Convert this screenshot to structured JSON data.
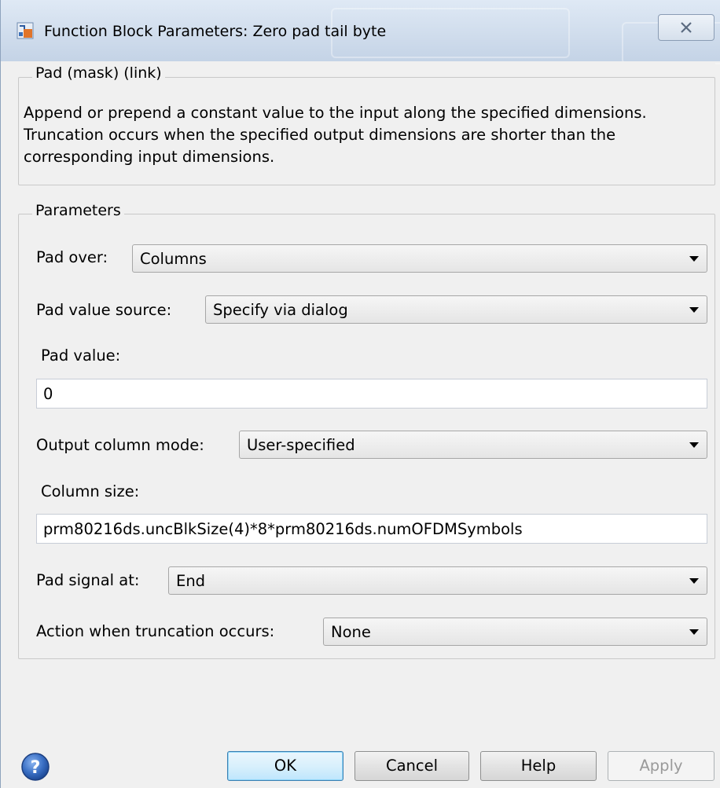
{
  "window": {
    "title": "Function Block Parameters: Zero pad tail byte"
  },
  "description_group": {
    "label": "Pad (mask) (link)",
    "text": "Append or prepend a constant value to the input along the specified dimensions.  Truncation occurs when the specified output dimensions are shorter than the corresponding input dimensions."
  },
  "parameters_group": {
    "label": "Parameters",
    "pad_over": {
      "label": "Pad over:",
      "value": "Columns"
    },
    "pad_value_source": {
      "label": "Pad value source:",
      "value": "Specify via dialog"
    },
    "pad_value": {
      "label": "Pad value:",
      "value": "0"
    },
    "output_column_mode": {
      "label": "Output column mode:",
      "value": "User-specified"
    },
    "column_size": {
      "label": "Column size:",
      "value": "prm80216ds.uncBlkSize(4)*8*prm80216ds.numOFDMSymbols"
    },
    "pad_signal_at": {
      "label": "Pad signal at:",
      "value": "End"
    },
    "action_truncation": {
      "label": "Action when truncation occurs:",
      "value": "None"
    }
  },
  "buttons": {
    "ok": "OK",
    "cancel": "Cancel",
    "help": "Help",
    "apply": "Apply"
  },
  "icons": {
    "app": "simulink-block-icon",
    "close": "close-icon",
    "help": "help-icon",
    "dropdown": "chevron-down-icon"
  }
}
